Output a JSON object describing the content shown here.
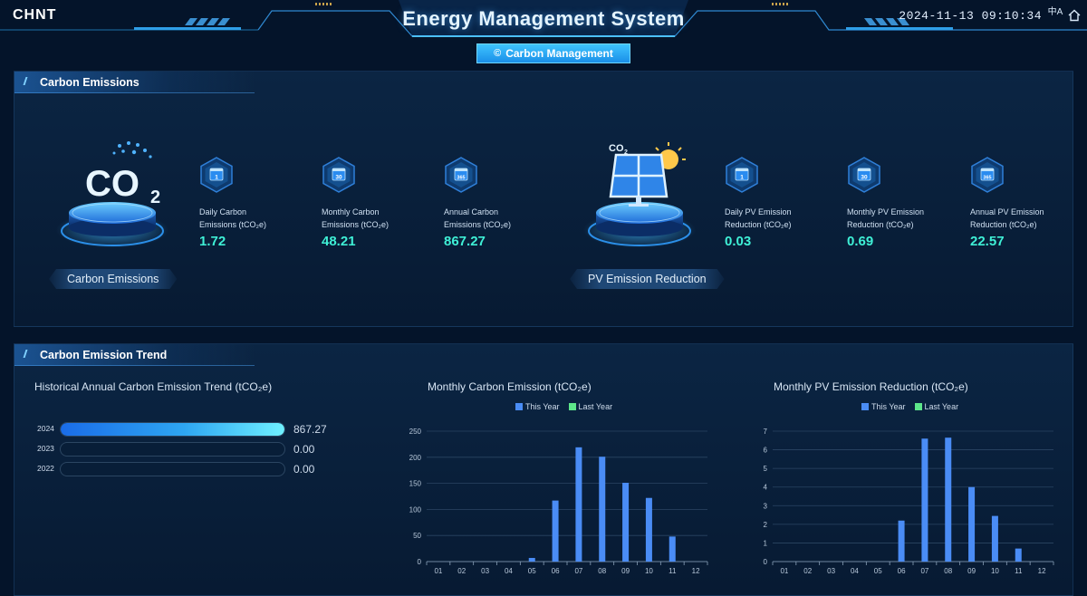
{
  "header": {
    "logo": "CHNT",
    "title": "Energy Management System",
    "datetime": "2024-11-13 09:10:34",
    "lang_glyph": "中A",
    "mode_button": "Carbon Management"
  },
  "emissions": {
    "section_title": "Carbon Emissions",
    "co2_glyph": "CO",
    "co2_sub": "2",
    "carbon_label": "Carbon Emissions",
    "pv_badge": "CO",
    "pv_badge_sub": "2",
    "pv_label": "PV Emission Reduction",
    "stats": [
      {
        "icon_text": "1",
        "label_1": "Daily Carbon",
        "label_2": "Emissions (tCO₂e)",
        "value": "1.72"
      },
      {
        "icon_text": "30",
        "label_1": "Monthly Carbon",
        "label_2": "Emissions (tCO₂e)",
        "value": "48.21"
      },
      {
        "icon_text": "365",
        "label_1": "Annual Carbon",
        "label_2": "Emissions (tCO₂e)",
        "value": "867.27"
      },
      {
        "icon_text": "1",
        "label_1": "Daily PV Emission",
        "label_2": "Reduction (tCO₂e)",
        "value": "0.03"
      },
      {
        "icon_text": "30",
        "label_1": "Monthly PV Emission",
        "label_2": "Reduction (tCO₂e)",
        "value": "0.69"
      },
      {
        "icon_text": "365",
        "label_1": "Annual PV Emission",
        "label_2": "Reduction (tCO₂e)",
        "value": "22.57"
      }
    ]
  },
  "trend": {
    "section_title": "Carbon Emission Trend"
  },
  "colors": {
    "accent": "#3ff0d6",
    "this_year": "#4a8cf5",
    "last_year": "#5de68a",
    "bar_fill_end": "#6ff0ff"
  },
  "chart_data": [
    {
      "type": "bar",
      "title": "Historical Annual Carbon Emission Trend (tCO₂e)",
      "orientation": "horizontal",
      "categories": [
        "2024",
        "2023",
        "2022"
      ],
      "values": [
        867.27,
        0.0,
        0.0
      ],
      "value_labels": [
        "867.27",
        "0.00",
        "0.00"
      ],
      "max": 867.27
    },
    {
      "type": "bar",
      "title": "Monthly Carbon Emission (tCO₂e)",
      "categories": [
        "01",
        "02",
        "03",
        "04",
        "05",
        "06",
        "07",
        "08",
        "09",
        "10",
        "11",
        "12"
      ],
      "series": [
        {
          "name": "This Year",
          "values": [
            0,
            0,
            0,
            0,
            7,
            117,
            219,
            201,
            151,
            122,
            48,
            0
          ]
        },
        {
          "name": "Last Year",
          "values": [
            0,
            0,
            0,
            0,
            0,
            0,
            0,
            0,
            0,
            0,
            0,
            0
          ]
        }
      ],
      "ylim": [
        0,
        250
      ],
      "yticks": [
        0,
        50,
        100,
        150,
        200,
        250
      ],
      "legend": "top-center",
      "grid": true
    },
    {
      "type": "bar",
      "title": "Monthly PV Emission Reduction (tCO₂e)",
      "categories": [
        "01",
        "02",
        "03",
        "04",
        "05",
        "06",
        "07",
        "08",
        "09",
        "10",
        "11",
        "12"
      ],
      "series": [
        {
          "name": "This Year",
          "values": [
            0,
            0,
            0,
            0,
            0,
            2.2,
            6.6,
            6.65,
            4.0,
            2.45,
            0.7,
            0
          ]
        },
        {
          "name": "Last Year",
          "values": [
            0,
            0,
            0,
            0,
            0,
            0,
            0,
            0,
            0,
            0,
            0,
            0
          ]
        }
      ],
      "ylim": [
        0,
        7
      ],
      "yticks": [
        0,
        1,
        2,
        3,
        4,
        5,
        6,
        7
      ],
      "legend": "top-center",
      "grid": true
    }
  ]
}
